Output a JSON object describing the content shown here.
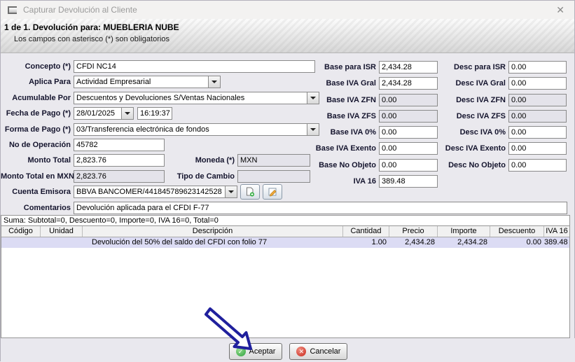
{
  "titlebar": {
    "title": "Capturar Devolución al Cliente",
    "close": "✕"
  },
  "banner": {
    "line1": "1 de 1. Devolución para: MUEBLERIA NUBE",
    "line2": "Los campos con asterisco (*) son obligatorios"
  },
  "fields": {
    "concepto": {
      "label": "Concepto (*)",
      "value": "CFDI NC14"
    },
    "aplica_para": {
      "label": "Aplica Para",
      "value": "Actividad Empresarial"
    },
    "acumulable_por": {
      "label": "Acumulable Por",
      "value": "Descuentos y Devoluciones S/Ventas Nacionales"
    },
    "fecha_de_pago": {
      "label": "Fecha de Pago (*)",
      "date": "28/01/2025",
      "time": "16:19:37"
    },
    "forma_de_pago": {
      "label": "Forma de Pago (*)",
      "value": "03/Transferencia electrónica de fondos"
    },
    "no_de_operacion": {
      "label": "No de Operación",
      "value": "45782"
    },
    "monto_total": {
      "label": "Monto Total",
      "value": "2,823.76"
    },
    "moneda": {
      "label": "Moneda (*)",
      "value": "MXN"
    },
    "monto_total_mxn": {
      "label": "Monto Total en MXN",
      "value": "2,823.76"
    },
    "tipo_de_cambio": {
      "label": "Tipo de Cambio",
      "value": ""
    },
    "cuenta_emisora": {
      "label": "Cuenta Emisora",
      "value": "BBVA BANCOMER/441845789623142528"
    },
    "comentarios": {
      "label": "Comentarios",
      "value": "Devolución aplicada para el CFDI F-77"
    }
  },
  "base_column": [
    {
      "label": "Base para ISR",
      "value": "2,434.28"
    },
    {
      "label": "Base IVA Gral",
      "value": "2,434.28"
    },
    {
      "label": "Base IVA ZFN",
      "value": "0.00"
    },
    {
      "label": "Base IVA ZFS",
      "value": "0.00"
    },
    {
      "label": "Base IVA 0%",
      "value": "0.00"
    },
    {
      "label": "Base IVA Exento",
      "value": "0.00"
    },
    {
      "label": "Base No Objeto",
      "value": "0.00"
    },
    {
      "label": "IVA 16",
      "value": "389.48"
    }
  ],
  "desc_column": [
    {
      "label": "Desc para ISR",
      "value": "0.00"
    },
    {
      "label": "Desc IVA Gral",
      "value": "0.00"
    },
    {
      "label": "Desc IVA ZFN",
      "value": "0.00"
    },
    {
      "label": "Desc IVA ZFS",
      "value": "0.00"
    },
    {
      "label": "Desc IVA 0%",
      "value": "0.00"
    },
    {
      "label": "Desc IVA Exento",
      "value": "0.00"
    },
    {
      "label": "Desc No Objeto",
      "value": "0.00"
    }
  ],
  "summary": "Suma: Subtotal=0, Descuento=0, Importe=0, IVA 16=0, Total=0",
  "table": {
    "headers": [
      "Código",
      "Unidad",
      "Descripción",
      "Cantidad",
      "Precio",
      "Importe",
      "Descuento",
      "IVA 16"
    ],
    "rows": [
      {
        "codigo": "",
        "unidad": "",
        "descripcion": "Devolución del 50% del saldo del CFDI con folio 77",
        "cantidad": "1.00",
        "precio": "2,434.28",
        "importe": "2,434.28",
        "descuento": "0.00",
        "iva16": "389.48"
      }
    ]
  },
  "buttons": {
    "accept": "Aceptar",
    "cancel": "Cancelar",
    "accept_icon": "✓",
    "cancel_icon": "✕"
  },
  "colors": {
    "annotation_arrow": "#20209d",
    "accept_icon_green": "#2da13c",
    "cancel_icon_red": "#c9281c",
    "selected_row": "#dcdcf4"
  }
}
